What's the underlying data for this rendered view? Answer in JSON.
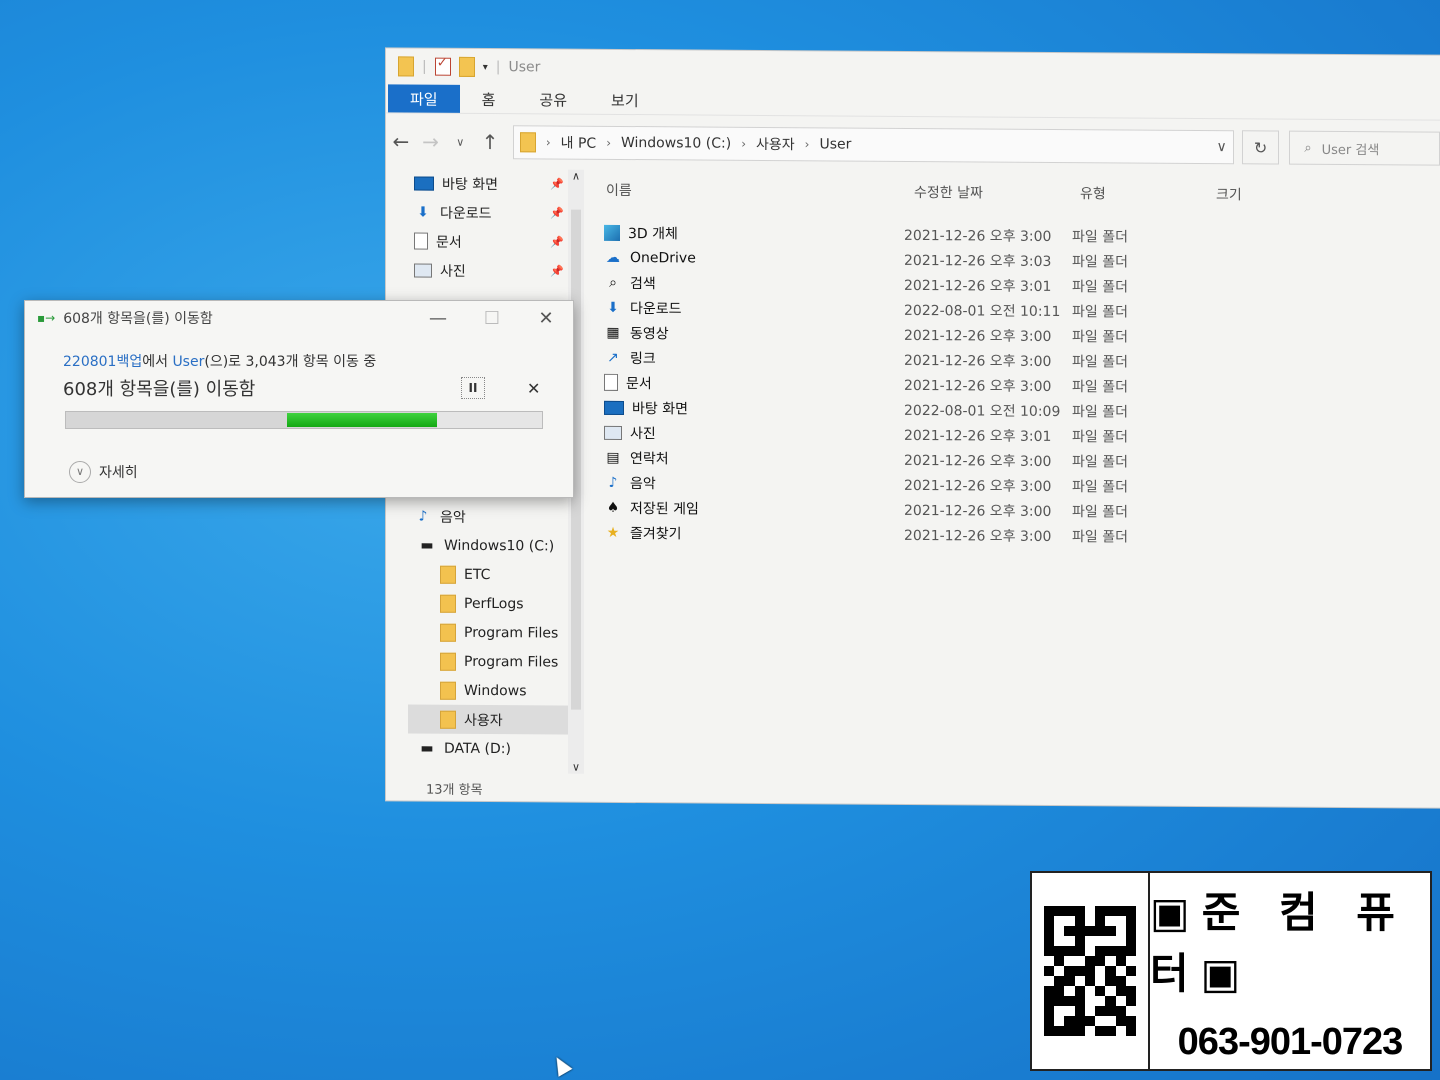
{
  "window": {
    "title": "User"
  },
  "ribbon": {
    "tabs": [
      "파일",
      "홈",
      "공유",
      "보기"
    ]
  },
  "address": {
    "crumbs": [
      "내 PC",
      "Windows10 (C:)",
      "사용자",
      "User"
    ],
    "search_placeholder": "User 검색"
  },
  "navpane": {
    "quick": [
      {
        "label": "바탕 화면",
        "icon": "desktop-icon"
      },
      {
        "label": "다운로드",
        "icon": "download-icon"
      },
      {
        "label": "문서",
        "icon": "document-icon"
      },
      {
        "label": "사진",
        "icon": "picture-icon"
      }
    ],
    "obscured_label": "바탕 화면",
    "lower": [
      {
        "label": "사진",
        "icon": "picture-icon"
      },
      {
        "label": "음악",
        "icon": "music-icon"
      },
      {
        "label": "Windows10 (C:)",
        "icon": "drive-icon"
      },
      {
        "label": "ETC",
        "icon": "folder-icon"
      },
      {
        "label": "PerfLogs",
        "icon": "folder-icon"
      },
      {
        "label": "Program Files",
        "icon": "folder-icon"
      },
      {
        "label": "Program Files",
        "icon": "folder-icon"
      },
      {
        "label": "Windows",
        "icon": "folder-icon"
      },
      {
        "label": "사용자",
        "icon": "folder-icon"
      },
      {
        "label": "DATA (D:)",
        "icon": "drive-icon"
      }
    ]
  },
  "status": {
    "count": "13개 항목"
  },
  "columns": {
    "name": "이름",
    "date": "수정한 날짜",
    "type": "유형",
    "size": "크기"
  },
  "files": [
    {
      "name": "3D 개체",
      "date": "2021-12-26 오후 3:00",
      "type": "파일 폴더",
      "icon": "3d-objects-icon"
    },
    {
      "name": "OneDrive",
      "date": "2021-12-26 오후 3:03",
      "type": "파일 폴더",
      "icon": "onedrive-icon"
    },
    {
      "name": "검색",
      "date": "2021-12-26 오후 3:01",
      "type": "파일 폴더",
      "icon": "search-icon"
    },
    {
      "name": "다운로드",
      "date": "2022-08-01 오전 10:11",
      "type": "파일 폴더",
      "icon": "download-icon"
    },
    {
      "name": "동영상",
      "date": "2021-12-26 오후 3:00",
      "type": "파일 폴더",
      "icon": "video-icon"
    },
    {
      "name": "링크",
      "date": "2021-12-26 오후 3:00",
      "type": "파일 폴더",
      "icon": "link-icon"
    },
    {
      "name": "문서",
      "date": "2021-12-26 오후 3:00",
      "type": "파일 폴더",
      "icon": "document-icon"
    },
    {
      "name": "바탕 화면",
      "date": "2022-08-01 오전 10:09",
      "type": "파일 폴더",
      "icon": "desktop-icon"
    },
    {
      "name": "사진",
      "date": "2021-12-26 오후 3:01",
      "type": "파일 폴더",
      "icon": "picture-icon"
    },
    {
      "name": "연락처",
      "date": "2021-12-26 오후 3:00",
      "type": "파일 폴더",
      "icon": "contacts-icon"
    },
    {
      "name": "음악",
      "date": "2021-12-26 오후 3:00",
      "type": "파일 폴더",
      "icon": "music-icon"
    },
    {
      "name": "저장된 게임",
      "date": "2021-12-26 오후 3:00",
      "type": "파일 폴더",
      "icon": "saved-games-icon"
    },
    {
      "name": "즐겨찾기",
      "date": "2021-12-26 오후 3:00",
      "type": "파일 폴더",
      "icon": "favorites-icon"
    }
  ],
  "dialog": {
    "title": "608개 항목을(를) 이동함",
    "source": "220801백업",
    "from_text": "에서 ",
    "dest": "User",
    "to_text": "(으)로 3,043개 항목 이동 중",
    "heading": "608개 항목을(를) 이동함",
    "progress": 0.78,
    "details_label": "자세히"
  },
  "ad": {
    "name": "준 컴 퓨 터",
    "phone": "063-901-0723"
  }
}
